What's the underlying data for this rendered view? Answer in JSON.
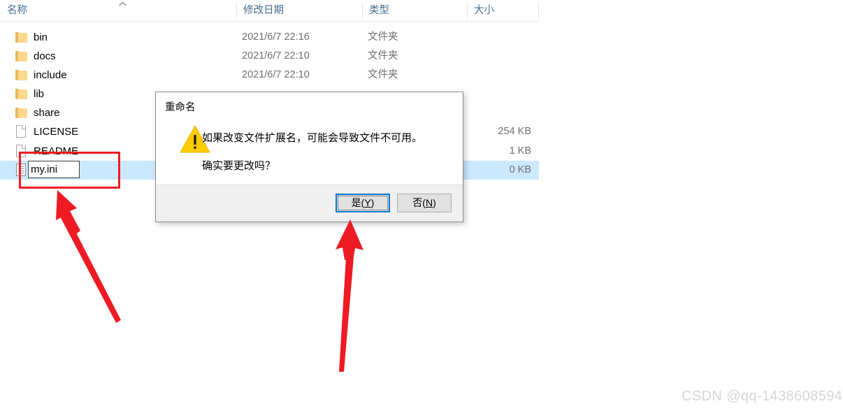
{
  "explorer": {
    "columns": [
      {
        "key": "name",
        "label": "名称"
      },
      {
        "key": "date",
        "label": "修改日期"
      },
      {
        "key": "type",
        "label": "类型"
      },
      {
        "key": "size",
        "label": "大小"
      }
    ],
    "sort_indicator": "ascending-chevron",
    "rows": [
      {
        "name": "bin",
        "date": "2021/6/7 22:16",
        "type": "文件夹",
        "size": "",
        "icon": "folder-icon",
        "selected": false
      },
      {
        "name": "docs",
        "date": "2021/6/7 22:10",
        "type": "文件夹",
        "size": "",
        "icon": "folder-icon",
        "selected": false
      },
      {
        "name": "include",
        "date": "2021/6/7 22:10",
        "type": "文件夹",
        "size": "",
        "icon": "folder-icon",
        "selected": false
      },
      {
        "name": "lib",
        "date": "",
        "type": "",
        "size": "",
        "icon": "folder-icon",
        "selected": false
      },
      {
        "name": "share",
        "date": "",
        "type": "",
        "size": "",
        "icon": "folder-icon",
        "selected": false
      },
      {
        "name": "LICENSE",
        "date": "",
        "type": "",
        "size": "254 KB",
        "icon": "file-icon",
        "selected": false
      },
      {
        "name": "README",
        "date": "",
        "type": "",
        "size": "1 KB",
        "icon": "file-icon",
        "selected": false
      },
      {
        "name": "",
        "date": "",
        "type": "",
        "size": "0 KB",
        "icon": "ini-file-icon",
        "selected": true
      }
    ],
    "rename": {
      "value": "my.ini",
      "placeholder": ""
    }
  },
  "dialog": {
    "title": "重命名",
    "icon": "warning-triangle-icon",
    "message_line1": "如果改变文件扩展名，可能会导致文件不可用。",
    "message_line2": "确实要更改吗？",
    "buttons": {
      "yes": {
        "text": "是",
        "accelerator": "Y",
        "focused": true
      },
      "no": {
        "text": "否",
        "accelerator": "N",
        "focused": false
      }
    }
  },
  "annotations": {
    "highlight_rect_color": "#ee1b24",
    "arrow_color": "#ee1b24",
    "arrow_to_rename_box": "points-up-left-at-filename-edit",
    "arrow_to_yes_button": "points-up-at-yes-button"
  },
  "watermark": {
    "text": "CSDN @qq-1438608594"
  }
}
